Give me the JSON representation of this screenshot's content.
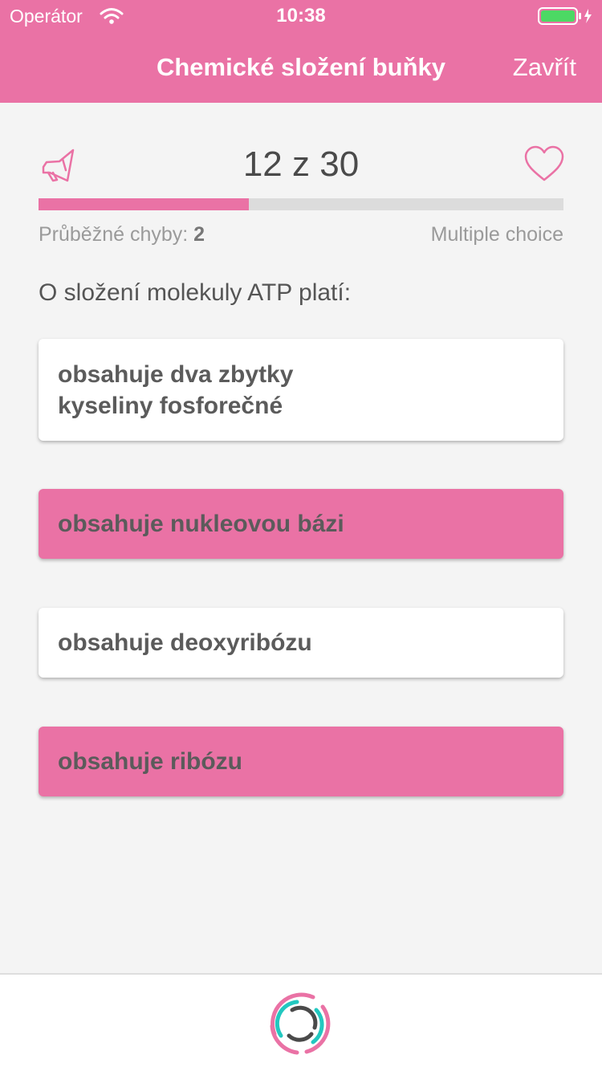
{
  "status_bar": {
    "carrier": "Operátor",
    "time": "10:38"
  },
  "nav": {
    "title": "Chemické složení buňky",
    "close_label": "Zavřít"
  },
  "quiz": {
    "counter": "12 z 30",
    "progress": 0.4,
    "errors_label": "Průběžné chyby:",
    "errors_count": "2",
    "question_type": "Multiple choice",
    "question": "O složení molekuly ATP platí:"
  },
  "answers": [
    {
      "text": "obsahuje dva zbytky\nkyseliny fosforečné",
      "selected": false
    },
    {
      "text": "obsahuje nukleovou bázi",
      "selected": true
    },
    {
      "text": "obsahuje deoxyribózu",
      "selected": false
    },
    {
      "text": "obsahuje ribózu",
      "selected": true
    }
  ],
  "colors": {
    "accent": "#ea72a5",
    "background": "#f4f4f4",
    "track": "#dcdcdc",
    "loader_teal": "#22c8c0",
    "loader_dark": "#4a4a4a"
  },
  "icons": {
    "megaphone": "megaphone-icon",
    "heart": "heart-icon",
    "wifi": "wifi-icon",
    "battery": "battery-icon",
    "loader": "loader-icon"
  }
}
